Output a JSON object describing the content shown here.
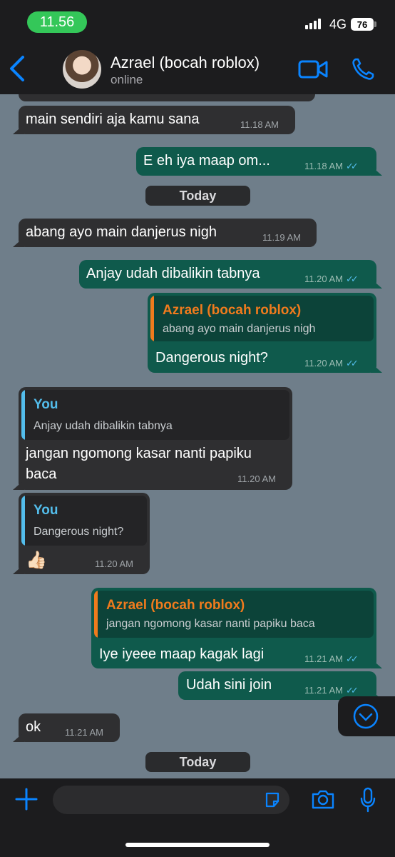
{
  "status": {
    "time": "11.56",
    "network": "4G",
    "battery": "76"
  },
  "header": {
    "name": "Azrael (bocah roblox)",
    "status": "online"
  },
  "messages": {
    "m0": {
      "text": "main sendiri aja kamu sana",
      "time": "11.18 AM"
    },
    "m1": {
      "text": "E eh iya maap om...",
      "time": "11.18 AM"
    },
    "m2": {
      "text": "abang ayo main danjerus nigh",
      "time": "11.19 AM"
    },
    "m3": {
      "text": "Anjay udah dibalikin tabnya",
      "time": "11.20 AM"
    },
    "m4": {
      "quote_name": "Azrael (bocah roblox)",
      "quote_text": "abang ayo main danjerus nigh",
      "text": "Dangerous night?",
      "time": "11.20 AM"
    },
    "m5": {
      "quote_name": "You",
      "quote_text": "Anjay udah dibalikin tabnya",
      "text_line1": "jangan ngomong kasar nanti papiku",
      "text_line2": "baca",
      "time": "11.20 AM"
    },
    "m6": {
      "quote_name": "You",
      "quote_text": "Dangerous night?",
      "text": "👍🏻",
      "time": "11.20 AM"
    },
    "m7": {
      "quote_name": "Azrael (bocah roblox)",
      "quote_text": "jangan ngomong kasar nanti papiku baca",
      "text": "Iye iyeee maap kagak lagi",
      "time": "11.21 AM"
    },
    "m8": {
      "text": "Udah sini join",
      "time": "11.21 AM"
    },
    "m9": {
      "text": "ok",
      "time": "11.21 AM"
    }
  },
  "day_labels": {
    "first": "Today",
    "second": "Today"
  },
  "ticks": "✓✓",
  "colors": {
    "incoming": "#2f2f31",
    "outgoing": "#0f5a4c",
    "accent": "#0a84ff",
    "quote_contact": "#f07b1d",
    "quote_you": "#53bdeb",
    "read_ticks": "#53bdeb"
  },
  "icons": [
    "back-chevron-icon",
    "video-call-icon",
    "phone-icon",
    "chevron-down-icon",
    "plus-icon",
    "sticker-icon",
    "camera-icon",
    "microphone-icon"
  ]
}
